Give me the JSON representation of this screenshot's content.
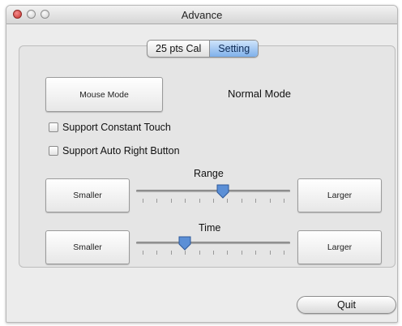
{
  "window": {
    "title": "Advance"
  },
  "tabs": [
    {
      "label": "25 pts Cal",
      "active": false
    },
    {
      "label": "Setting",
      "active": true
    }
  ],
  "mode": {
    "button_label": "Mouse Mode",
    "current_mode": "Normal Mode"
  },
  "options": {
    "constant_touch": {
      "label": "Support Constant Touch",
      "checked": false
    },
    "auto_right": {
      "label": "Support Auto Right Button",
      "checked": false
    }
  },
  "range": {
    "label": "Range",
    "smaller_label": "Smaller",
    "larger_label": "Larger",
    "value": 0.57
  },
  "time": {
    "label": "Time",
    "smaller_label": "Smaller",
    "larger_label": "Larger",
    "value": 0.3
  },
  "footer": {
    "quit_label": "Quit"
  },
  "colors": {
    "active_tab": "#7fb0ea",
    "thumb": "#5b8fd6",
    "close_button": "#c9322e"
  }
}
